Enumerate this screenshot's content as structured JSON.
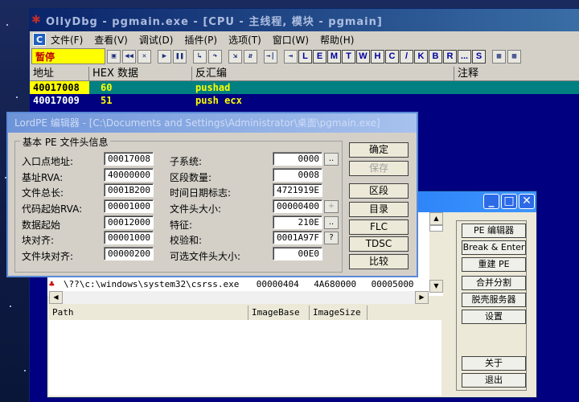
{
  "olly": {
    "title": "OllyDbg - pgmain.exe - [CPU - 主线程, 模块 - pgmain]",
    "menu": [
      "文件(F)",
      "查看(V)",
      "调试(D)",
      "插件(P)",
      "选项(T)",
      "窗口(W)",
      "帮助(H)"
    ],
    "status": "暂停",
    "toolbar_letters": [
      "L",
      "E",
      "M",
      "T",
      "W",
      "H",
      "C",
      "/",
      "K",
      "B",
      "R",
      "...",
      "S"
    ],
    "columns": [
      "地址",
      "HEX 数据",
      "反汇编",
      "注释"
    ],
    "rows": [
      {
        "addr": "40017008",
        "hex": "60",
        "asm": "pushad"
      },
      {
        "addr": "40017009",
        "hex": "51",
        "asm": "push ecx"
      }
    ]
  },
  "pe": {
    "title": "LordPE 编辑器 - [C:\\Documents and Settings\\Administrator\\桌面\\pgmain.exe]",
    "group_title": "基本 PE 文件头信息",
    "left": [
      {
        "label": "入口点地址:",
        "value": "00017008"
      },
      {
        "label": "基址RVA:",
        "value": "40000000"
      },
      {
        "label": "文件总长:",
        "value": "0001B200"
      },
      {
        "label": "代码起始RVA:",
        "value": "00001000"
      },
      {
        "label": "数据起始",
        "value": "00012000"
      },
      {
        "label": "块对齐:",
        "value": "00001000"
      },
      {
        "label": "文件块对齐:",
        "value": "00000200"
      }
    ],
    "right": [
      {
        "label": "子系统:",
        "value": "0000"
      },
      {
        "label": "区段数量:",
        "value": "0008"
      },
      {
        "label": "时间日期标志:",
        "value": "4721919E"
      },
      {
        "label": "文件头大小:",
        "value": "00000400"
      },
      {
        "label": "特征:",
        "value": "210E"
      },
      {
        "label": "校验和:",
        "value": "0001A97F"
      },
      {
        "label": "可选文件头大小:",
        "value": "00E0"
      }
    ],
    "mini_buttons": [
      "..",
      "+",
      "..",
      "?"
    ],
    "buttons": [
      "确定",
      "保存",
      "区段",
      "目录",
      "FLC",
      "TDSC",
      "比较"
    ]
  },
  "proc": {
    "row": {
      "path": "\\??\\c:\\windows\\system32\\csrss.exe",
      "pid": "00000404",
      "base": "4A680000",
      "size": "00005000"
    },
    "mod_columns": [
      "Path",
      "ImageBase",
      "ImageSize"
    ],
    "buttons": [
      "PE 编辑器",
      "Break & Enter",
      "重建 PE",
      "合并分割",
      "脱壳服务器",
      "设置",
      "关于",
      "退出"
    ]
  }
}
